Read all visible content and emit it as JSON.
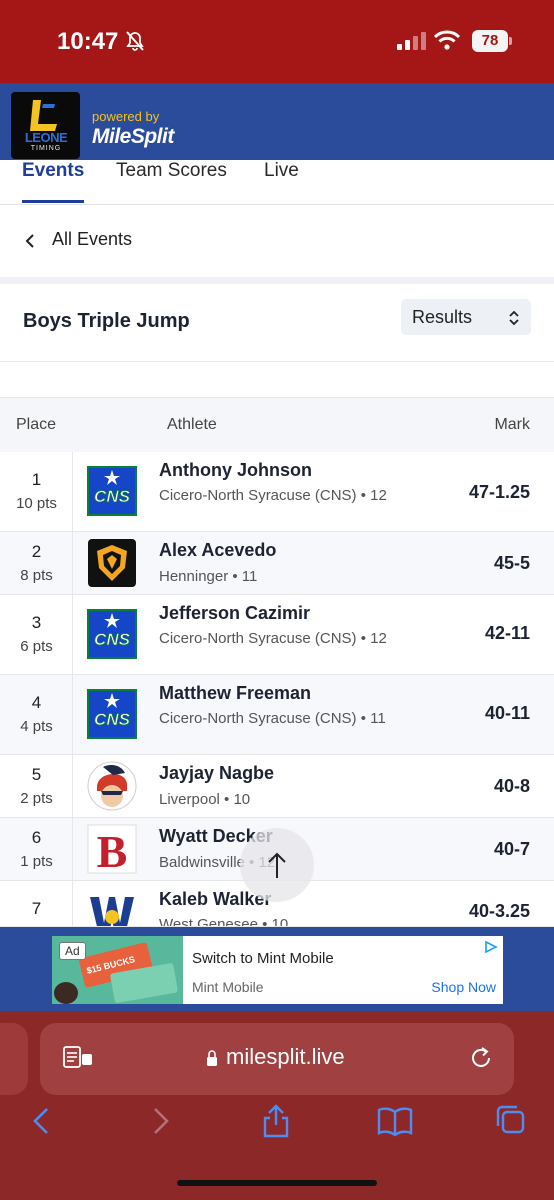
{
  "status_bar": {
    "time": "10:47",
    "battery": "78"
  },
  "header": {
    "logo_word": "LEONE",
    "logo_sub": "TIMING",
    "powered_by": "powered by",
    "brand": "MileSplit"
  },
  "tabs": [
    {
      "label": "Events",
      "active": true
    },
    {
      "label": "Team Scores",
      "active": false
    },
    {
      "label": "Live",
      "active": false
    }
  ],
  "back": {
    "label": "All Events"
  },
  "event": {
    "title": "Boys Triple Jump",
    "view_select": "Results"
  },
  "table": {
    "headers": {
      "place": "Place",
      "athlete": "Athlete",
      "mark": "Mark"
    },
    "rows": [
      {
        "place": "1",
        "pts": "10 pts",
        "name": "Anthony Johnson",
        "team": "Cicero-North Syracuse (CNS) • 12",
        "mark": "47-1.25",
        "logo": "cns-logo"
      },
      {
        "place": "2",
        "pts": "8 pts",
        "name": "Alex Acevedo",
        "team": "Henninger • 11",
        "mark": "45-5",
        "logo": "henninger-logo"
      },
      {
        "place": "3",
        "pts": "6 pts",
        "name": "Jefferson Cazimir",
        "team": "Cicero-North Syracuse (CNS) • 12",
        "mark": "42-11",
        "logo": "cns-logo"
      },
      {
        "place": "4",
        "pts": "4 pts",
        "name": "Matthew Freeman",
        "team": "Cicero-North Syracuse (CNS) • 11",
        "mark": "40-11",
        "logo": "cns-logo"
      },
      {
        "place": "5",
        "pts": "2 pts",
        "name": "Jayjay Nagbe",
        "team": "Liverpool • 10",
        "mark": "40-8",
        "logo": "liverpool-logo"
      },
      {
        "place": "6",
        "pts": "1 pts",
        "name": "Wyatt Decker",
        "team": "Baldwinsville • 12",
        "mark": "40-7",
        "logo": "baldwinsville-logo"
      },
      {
        "place": "7",
        "pts": "",
        "name": "Kaleb Walker",
        "team": "West Genesee • 10",
        "mark": "40-3.25",
        "logo": "west-genesee-logo"
      }
    ]
  },
  "ad": {
    "badge": "Ad",
    "title": "Switch to Mint Mobile",
    "sponsor": "Mint Mobile",
    "cta": "Shop Now",
    "card_text": "$15 BUCKS"
  },
  "browser": {
    "url": "milesplit.live"
  },
  "colors": {
    "status_red": "#a51717",
    "header_blue": "#2b4b9b",
    "accent_blue": "#1f3d99",
    "browser_red": "#8d2828"
  }
}
